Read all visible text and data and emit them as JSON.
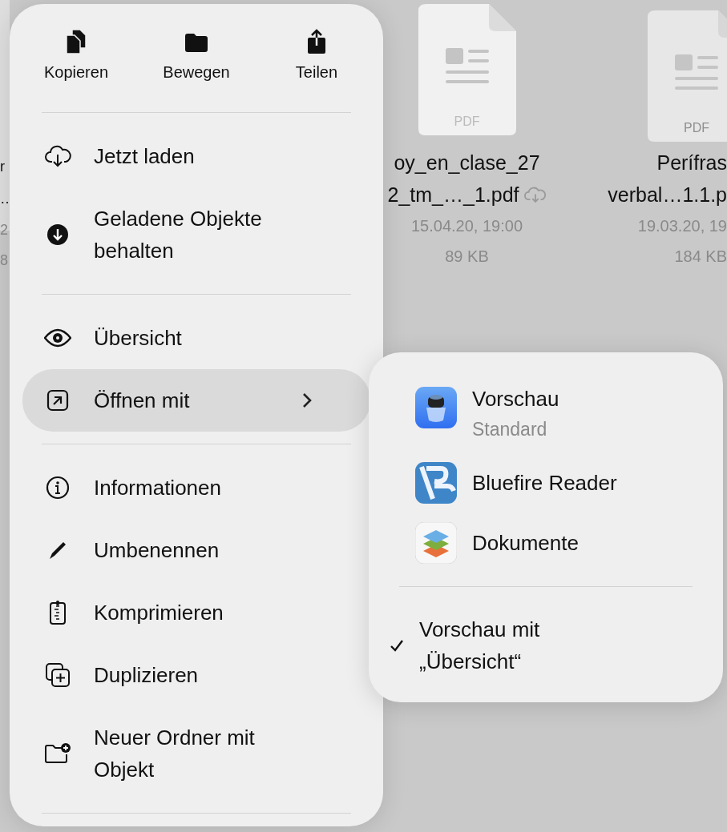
{
  "files": [
    {
      "name_lines": [
        "r",
        "…"
      ],
      "date": "2",
      "size": "8",
      "cloud": false,
      "kind": "fragment"
    },
    {
      "name_lines": [
        "oy_en_clase_27",
        "2_tm_…_1.pdf"
      ],
      "date": "15.04.20, 19:00",
      "size": "89 KB",
      "cloud": true,
      "kind": "pdf",
      "badge": "PDF"
    },
    {
      "name_lines": [
        "Perífras",
        "verbal…1.1.p"
      ],
      "date": "19.03.20, 19",
      "size": "184 KB",
      "cloud": false,
      "kind": "pdf-edge",
      "badge": "PDF"
    }
  ],
  "context_menu": {
    "actions": [
      {
        "label": "Kopieren"
      },
      {
        "label": "Bewegen"
      },
      {
        "label": "Teilen"
      }
    ],
    "sections": [
      [
        {
          "label": "Jetzt laden",
          "selected": false,
          "submenu": false
        },
        {
          "label": "Geladene Objekte behalten",
          "selected": false,
          "submenu": false
        }
      ],
      [
        {
          "label": "Übersicht",
          "selected": false,
          "submenu": false
        },
        {
          "label": "Öffnen mit",
          "selected": true,
          "submenu": true
        }
      ],
      [
        {
          "label": "Informationen",
          "selected": false,
          "submenu": false
        },
        {
          "label": "Umbenennen",
          "selected": false,
          "submenu": false
        },
        {
          "label": "Komprimieren",
          "selected": false,
          "submenu": false
        },
        {
          "label": "Duplizieren",
          "selected": false,
          "submenu": false
        },
        {
          "label": "Neuer Ordner mit Objekt",
          "selected": false,
          "submenu": false
        }
      ]
    ]
  },
  "open_with_menu": {
    "apps": [
      {
        "name": "Vorschau",
        "subtitle": "Standard"
      },
      {
        "name": "Bluefire Reader"
      },
      {
        "name": "Dokumente"
      }
    ],
    "options": [
      {
        "label": "Vorschau mit „Übersicht“",
        "checked": true
      }
    ]
  }
}
